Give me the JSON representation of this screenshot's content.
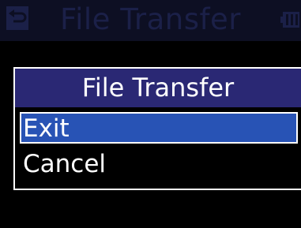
{
  "header": {
    "title": "File Transfer",
    "back_icon": "return-arrow-icon",
    "battery_icon": "battery-icon"
  },
  "dialog": {
    "title": "File Transfer",
    "items": [
      {
        "label": "Exit",
        "selected": true
      },
      {
        "label": "Cancel",
        "selected": false
      }
    ]
  },
  "colors": {
    "dialog_header": "#2a2874",
    "selection": "#2853b5",
    "dimmed_title_bar": "#0d0f23"
  }
}
